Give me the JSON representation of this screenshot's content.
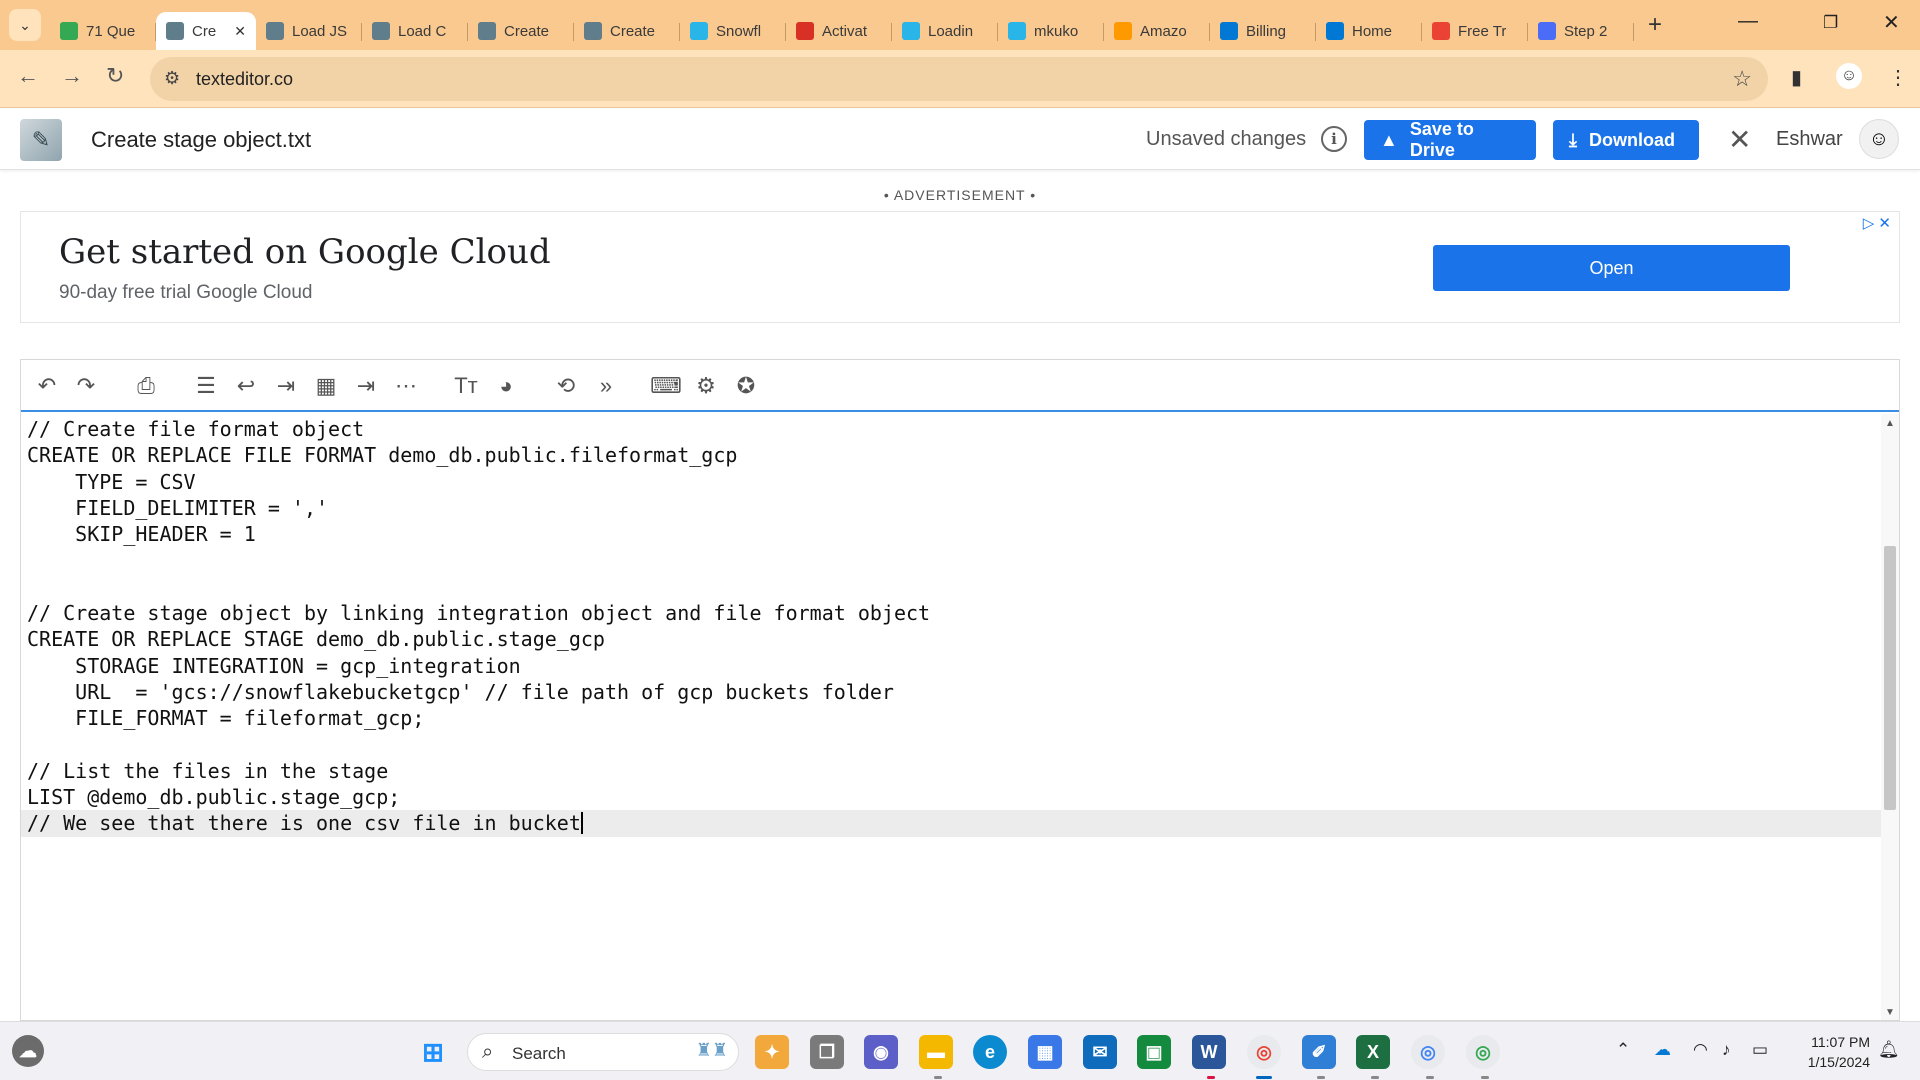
{
  "browser": {
    "tabs": [
      {
        "label": "71 Que",
        "icon": "drive-icon",
        "color": "#34a853"
      },
      {
        "label": "Cre",
        "icon": "texteditor-icon",
        "color": "#607d8b",
        "active": true
      },
      {
        "label": "Load JS",
        "icon": "texteditor-icon",
        "color": "#607d8b"
      },
      {
        "label": "Load C",
        "icon": "texteditor-icon",
        "color": "#607d8b"
      },
      {
        "label": "Create",
        "icon": "texteditor-icon",
        "color": "#607d8b"
      },
      {
        "label": "Create",
        "icon": "texteditor-icon",
        "color": "#607d8b"
      },
      {
        "label": "Snowfl",
        "icon": "snowflake-icon",
        "color": "#29b5e8"
      },
      {
        "label": "Activat",
        "icon": "gmail-icon",
        "color": "#d93025"
      },
      {
        "label": "Loadin",
        "icon": "snowflake-icon",
        "color": "#29b5e8"
      },
      {
        "label": "mkuko",
        "icon": "snowflake-icon",
        "color": "#29b5e8"
      },
      {
        "label": "Amazo",
        "icon": "aws-icon",
        "color": "#ff9900"
      },
      {
        "label": "Billing",
        "icon": "azure-icon",
        "color": "#0078d4"
      },
      {
        "label": "Home",
        "icon": "azure-icon",
        "color": "#0078d4"
      },
      {
        "label": "Free Tr",
        "icon": "google-cloud-icon",
        "color": "#ea4335"
      },
      {
        "label": "Step 2",
        "icon": "dbt-icon",
        "color": "#4a6cf7"
      }
    ],
    "new_tab": "+",
    "url": "texteditor.co"
  },
  "app": {
    "doc_title": "Create stage object.txt",
    "status": "Unsaved changes",
    "save_drive_label": "Save to Drive",
    "download_label": "Download",
    "username": "Eshwar"
  },
  "ad": {
    "label": "• ADVERTISEMENT •",
    "headline": "Get started on Google Cloud",
    "subline": "90-day free trial Google Cloud",
    "button": "Open"
  },
  "editor": {
    "lines": [
      "// Create file format object",
      "CREATE OR REPLACE FILE FORMAT demo_db.public.fileformat_gcp",
      "    TYPE = CSV",
      "    FIELD_DELIMITER = ','",
      "    SKIP_HEADER = 1",
      "",
      "",
      "// Create stage object by linking integration object and file format object",
      "CREATE OR REPLACE STAGE demo_db.public.stage_gcp",
      "    STORAGE INTEGRATION = gcp_integration",
      "    URL  = 'gcs://snowflakebucketgcp' // file path of gcp buckets folder",
      "    FILE_FORMAT = fileformat_gcp;",
      "",
      "// List the files in the stage",
      "LIST @demo_db.public.stage_gcp;",
      "// We see that there is one csv file in bucket"
    ],
    "current_line": 15
  },
  "taskbar": {
    "search_label": "Search",
    "time": "11:07 PM",
    "date": "1/15/2024"
  }
}
